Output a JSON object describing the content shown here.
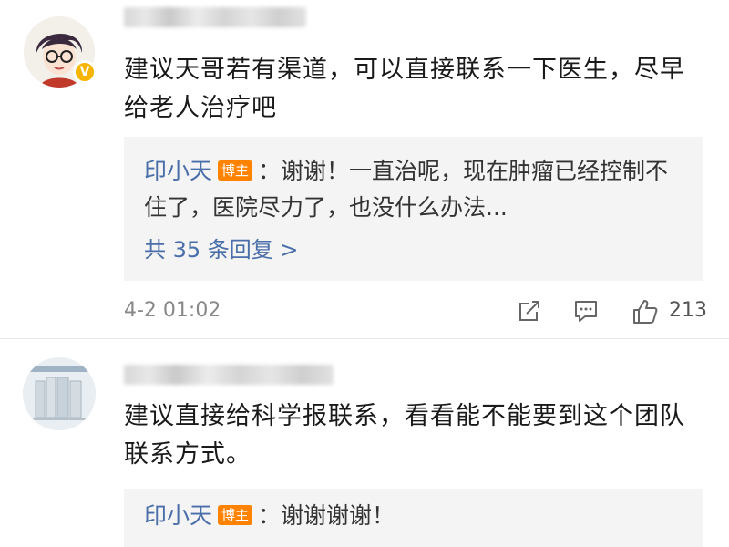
{
  "comments": [
    {
      "text": "建议天哥若有渠道，可以直接联系一下医生，尽早给老人治疗吧",
      "reply": {
        "author": "印小天",
        "badge": "博主",
        "text": "：谢谢！一直治呢，现在肿瘤已经控制不住了，医院尽力了，也没什么办法..."
      },
      "more_replies": "共 35 条回复 >",
      "time": "4-2 01:02",
      "likes": "213"
    },
    {
      "text": "建议直接给科学报联系，看看能不能要到这个团队联系方式。",
      "reply": {
        "author": "印小天",
        "badge": "博主",
        "text": "：谢谢谢谢！"
      }
    }
  ],
  "icons": [
    "verified-badge-icon",
    "share-icon",
    "comment-icon",
    "like-icon"
  ],
  "colors": {
    "link": "#4a6ea9",
    "badge": "#ff8200",
    "verified": "#f7b500"
  }
}
